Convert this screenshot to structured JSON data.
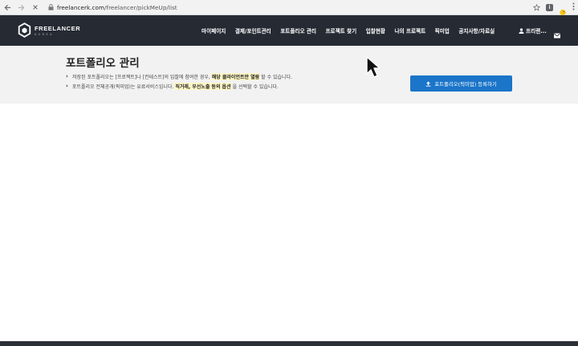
{
  "browser": {
    "url_host": "freelancerk.com",
    "url_path": "/freelancer/pickMeUp/list",
    "ext_i_label": "i"
  },
  "header": {
    "logo_main": "FREELANCER",
    "logo_sub": "KOREA",
    "nav": [
      {
        "label": "마이페이지"
      },
      {
        "label": "결제/포인트관리"
      },
      {
        "label": "포트폴리오 관리"
      },
      {
        "label": "프로젝트 찾기"
      },
      {
        "label": "입찰현황"
      },
      {
        "label": "나의 프로젝트"
      },
      {
        "label": "픽미업"
      },
      {
        "label": "공지사항/자료실"
      }
    ],
    "user_label": "프리랜..."
  },
  "subheader": {
    "title": "포트폴리오 관리",
    "note1_pre": "저장된 포트폴리오는 [프로젝트]나 [컨테스트]의 입찰에 참여한 경우,",
    "note1_hl": "해당 클라이언트만 열람",
    "note1_post": "할 수 있습니다.",
    "note2_pre": "포트폴리오 전체공개(픽미업)는 유료서비스입니다.",
    "note2_hl": "직거래, 우선노출 등의 옵션",
    "note2_post": "을 선택할 수 있습니다.",
    "register_button": "포트폴리오(픽미업) 등록하기"
  },
  "colors": {
    "header_bg": "#252a33",
    "button_bg": "#1b75c9",
    "subheader_bg": "#f2f2f2",
    "highlight": "#fff7c6"
  }
}
